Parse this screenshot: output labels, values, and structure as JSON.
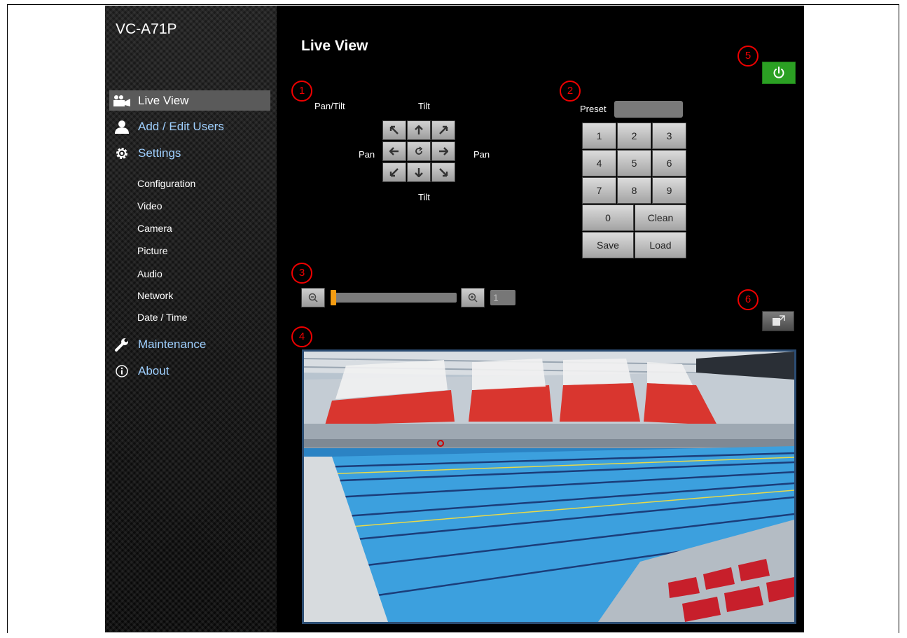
{
  "device_name": "VC-A71P",
  "page_title": "Live View",
  "sidebar": {
    "nav": [
      {
        "label": "Live View",
        "icon": "camera-icon",
        "active": true
      },
      {
        "label": "Add / Edit Users",
        "icon": "user-icon"
      },
      {
        "label": "Settings",
        "icon": "gear-icon"
      },
      {
        "label": "Maintenance",
        "icon": "wrench-icon"
      },
      {
        "label": "About",
        "icon": "info-icon"
      }
    ],
    "settings_sub": [
      "Configuration",
      "Video",
      "Camera",
      "Picture",
      "Audio",
      "Network",
      "Date / Time"
    ]
  },
  "annotations": [
    "1",
    "2",
    "3",
    "4",
    "5",
    "6"
  ],
  "ptz": {
    "pan_tilt_label": "Pan/Tilt",
    "tilt_top": "Tilt",
    "tilt_bottom": "Tilt",
    "pan_left": "Pan",
    "pan_right": "Pan",
    "arrows": [
      "up-left",
      "up",
      "up-right",
      "left",
      "home",
      "right",
      "down-left",
      "down",
      "down-right"
    ]
  },
  "preset": {
    "label": "Preset",
    "value": "",
    "keys": [
      "1",
      "2",
      "3",
      "4",
      "5",
      "6",
      "7",
      "8",
      "9",
      "0",
      "Clean",
      "Save",
      "Load"
    ]
  },
  "zoom": {
    "value": "1",
    "position": 0
  },
  "colors": {
    "power": "#2ba023",
    "slider_handle": "#f39c12",
    "annotation": "#e00000",
    "active_nav": "#5a5a5a"
  }
}
